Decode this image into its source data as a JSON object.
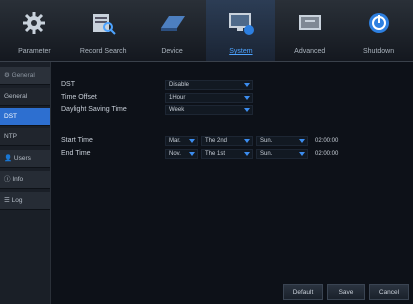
{
  "tabs": [
    {
      "label": "Parameter",
      "icon": "gear-icon"
    },
    {
      "label": "Record Search",
      "icon": "record-search-icon"
    },
    {
      "label": "Device",
      "icon": "hdd-icon"
    },
    {
      "label": "System",
      "icon": "system-monitor-icon",
      "active": true
    },
    {
      "label": "Advanced",
      "icon": "advanced-icon"
    },
    {
      "label": "Shutdown",
      "icon": "shutdown-icon"
    }
  ],
  "sidebar": {
    "items": [
      {
        "label": "General",
        "kind": "header"
      },
      {
        "label": "General",
        "kind": "sub"
      },
      {
        "label": "DST",
        "kind": "active"
      },
      {
        "label": "NTP",
        "kind": "sub"
      },
      {
        "label": "Users",
        "kind": "cat"
      },
      {
        "label": "Info",
        "kind": "cat"
      },
      {
        "label": "Log",
        "kind": "cat"
      }
    ]
  },
  "form": {
    "dst": {
      "label": "DST",
      "value": "Disable"
    },
    "time_offset": {
      "label": "Time Offset",
      "value": "1Hour"
    },
    "dst_mode": {
      "label": "Daylight Saving Time",
      "value": "Week"
    },
    "start_time": {
      "label": "Start Time",
      "month": "Mar.",
      "week": "The 2nd",
      "day": "Sun.",
      "time": "02:00:00"
    },
    "end_time": {
      "label": "End Time",
      "month": "Nov.",
      "week": "The 1st",
      "day": "Sun.",
      "time": "02:00:00"
    }
  },
  "buttons": {
    "default": "Default",
    "save": "Save",
    "cancel": "Cancel"
  },
  "colors": {
    "accent": "#2d6fd0",
    "active_tab_text": "#4da3ff"
  }
}
